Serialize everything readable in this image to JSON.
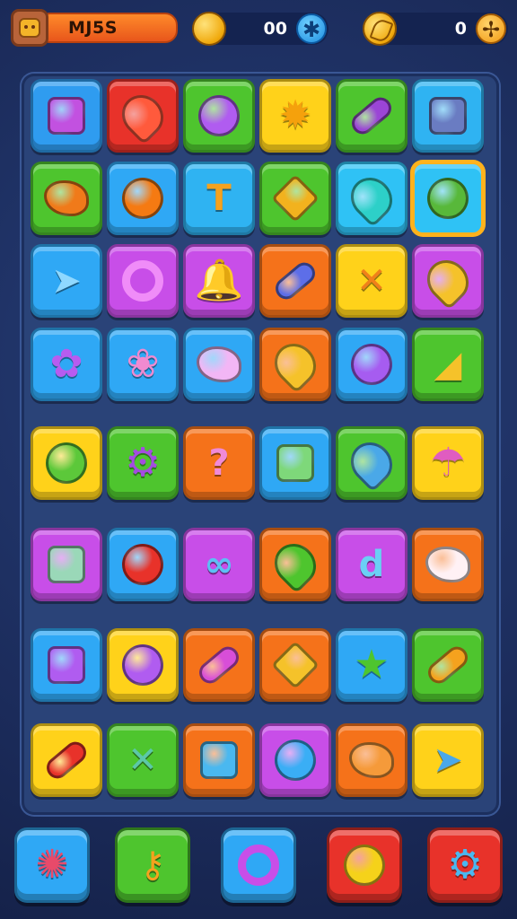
{
  "player": {
    "name": "MJ5S"
  },
  "currencies": [
    {
      "name": "coins",
      "value": "00",
      "icon": "gold-coin-icon"
    },
    {
      "name": "leaves",
      "value": "0",
      "icon": "gold-leaf-icon"
    }
  ],
  "board": {
    "rows": [
      [
        {
          "bg": "#2f9cf0",
          "icon": "robot-cart",
          "shape": "square",
          "color": "#c251e0"
        },
        {
          "bg": "#e8322a",
          "icon": "red-balloon",
          "shape": "drop",
          "color": "#ff5a3c"
        },
        {
          "bg": "#4ec52e",
          "icon": "purple-balloon",
          "shape": "circle",
          "color": "#b05cf0"
        },
        {
          "bg": "#ffd21a",
          "icon": "sun",
          "shape": "star",
          "color": "#f5a10c",
          "glyph": "✹"
        },
        {
          "bg": "#4ec52e",
          "icon": "purple-bug",
          "shape": "pill",
          "color": "#9b45d6"
        },
        {
          "bg": "#2fb3f2",
          "icon": "cassette",
          "shape": "square",
          "color": "#6a7cc2"
        }
      ],
      [
        {
          "bg": "#4ec52e",
          "icon": "orange-whistle",
          "shape": "blob",
          "color": "#f07a1a"
        },
        {
          "bg": "#2fa8f5",
          "icon": "orange-balloon",
          "shape": "circle",
          "color": "#f57a12"
        },
        {
          "bg": "#2fb3f2",
          "icon": "mushroom-stick",
          "shape": "glyph",
          "color": "#f5a21e",
          "glyph": "T"
        },
        {
          "bg": "#4ec52e",
          "icon": "gold-spinner",
          "shape": "diamond",
          "color": "#f2b21e"
        },
        {
          "bg": "#2fc2f5",
          "icon": "teal-shield",
          "shape": "drop",
          "color": "#2dd0c8"
        },
        {
          "bg": "#2fc2f5",
          "icon": "green-melon",
          "shape": "circle",
          "color": "#58b83a",
          "selected": true
        }
      ],
      [
        {
          "bg": "#2fa8f5",
          "icon": "paper-plane",
          "shape": "glyph",
          "color": "#8fd8ff",
          "glyph": "➤"
        },
        {
          "bg": "#c84ee8",
          "icon": "purple-ring",
          "shape": "ring",
          "color": "#f08cf8"
        },
        {
          "bg": "#c84ee8",
          "icon": "gold-bell",
          "shape": "star",
          "color": "#f5b21e",
          "glyph": "🔔"
        },
        {
          "bg": "#f5721a",
          "icon": "blue-gem",
          "shape": "pill",
          "color": "#5d6ee8"
        },
        {
          "bg": "#ffd21a",
          "icon": "crossed-arrows",
          "shape": "glyph",
          "color": "#f0801a",
          "glyph": "✕"
        },
        {
          "bg": "#c84ee8",
          "icon": "gold-rocket",
          "shape": "drop",
          "color": "#f5c22a"
        }
      ],
      [
        {
          "bg": "#2fa8f5",
          "icon": "purple-flower",
          "shape": "star",
          "color": "#b75cf0",
          "glyph": "✿"
        },
        {
          "bg": "#2fa8f5",
          "icon": "pink-lotus",
          "shape": "star",
          "color": "#f08ad0",
          "glyph": "❀"
        },
        {
          "bg": "#2fa8f5",
          "icon": "pink-cloud",
          "shape": "blob",
          "color": "#f2b6f5"
        },
        {
          "bg": "#f5721a",
          "icon": "gold-leaf",
          "shape": "drop",
          "color": "#f5c22a"
        },
        {
          "bg": "#2fa8f5",
          "icon": "purple-bird",
          "shape": "circle",
          "color": "#a65cf0"
        },
        {
          "bg": "#4ec52e",
          "icon": "gold-triangle",
          "shape": "glyph",
          "color": "#f5c22a",
          "glyph": "◢"
        }
      ],
      [
        {
          "bg": "#ffd21a",
          "icon": "green-smiley",
          "shape": "circle",
          "color": "#5cc83a"
        },
        {
          "bg": "#4ec52e",
          "icon": "purple-gear",
          "shape": "star",
          "color": "#a44ce0",
          "glyph": "⚙"
        },
        {
          "bg": "#f5721a",
          "icon": "pink-question",
          "shape": "glyph",
          "color": "#f08ad8",
          "glyph": "?"
        },
        {
          "bg": "#2fa8f5",
          "icon": "green-pencil-card",
          "shape": "square",
          "color": "#7ed87a"
        },
        {
          "bg": "#4ec52e",
          "icon": "blue-leaf",
          "shape": "drop",
          "color": "#4aa8e8"
        },
        {
          "bg": "#ffd21a",
          "icon": "umbrella",
          "shape": "star",
          "color": "#e05cc0",
          "glyph": "☂"
        }
      ],
      [
        {
          "bg": "#c84ee8",
          "icon": "plant-pot",
          "shape": "square",
          "color": "#9ad8b8"
        },
        {
          "bg": "#2fa8f5",
          "icon": "red-ball",
          "shape": "circle",
          "color": "#e8322a"
        },
        {
          "bg": "#c84ee8",
          "icon": "blue-infinity",
          "shape": "glyph",
          "color": "#5cc0f5",
          "glyph": "∞"
        },
        {
          "bg": "#f5721a",
          "icon": "green-plant",
          "shape": "drop",
          "color": "#4ec52e"
        },
        {
          "bg": "#c84ee8",
          "icon": "blue-letter",
          "shape": "glyph",
          "color": "#6ad0f5",
          "glyph": "d"
        },
        {
          "bg": "#f5721a",
          "icon": "bunny-face",
          "shape": "blob",
          "color": "#fff1f5"
        }
      ],
      [
        {
          "bg": "#2fa8f5",
          "icon": "purple-box",
          "shape": "square",
          "color": "#b05cf0"
        },
        {
          "bg": "#ffd21a",
          "icon": "purple-egg",
          "shape": "circle",
          "color": "#b05cf0"
        },
        {
          "bg": "#f5721a",
          "icon": "purple-lantern",
          "shape": "pill",
          "color": "#d84ed8"
        },
        {
          "bg": "#f5721a",
          "icon": "gold-tile",
          "shape": "diamond",
          "color": "#f5c22a"
        },
        {
          "bg": "#2fa8f5",
          "icon": "green-star",
          "shape": "star",
          "color": "#4ec52e",
          "glyph": "★"
        },
        {
          "bg": "#4ec52e",
          "icon": "pencil",
          "shape": "pill",
          "color": "#f5a21e"
        }
      ],
      [
        {
          "bg": "#ffd21a",
          "icon": "red-chili",
          "shape": "pill",
          "color": "#e8322a"
        },
        {
          "bg": "#4ec52e",
          "icon": "green-sword",
          "shape": "glyph",
          "color": "#5cc8a8",
          "glyph": "✕"
        },
        {
          "bg": "#f5721a",
          "icon": "blue-key",
          "shape": "square",
          "color": "#4ab8f0"
        },
        {
          "bg": "#c84ee8",
          "icon": "blue-balloon",
          "shape": "circle",
          "color": "#3aaef5"
        },
        {
          "bg": "#f5721a",
          "icon": "orange-heart",
          "shape": "blob",
          "color": "#f59a3a"
        },
        {
          "bg": "#ffd21a",
          "icon": "blue-plane",
          "shape": "glyph",
          "color": "#4aa8e8",
          "glyph": "➤"
        }
      ]
    ]
  },
  "powerups": [
    {
      "name": "sun-badge",
      "bg": "#2fa8f5",
      "shape": "star",
      "color": "#e84a6a",
      "glyph": "✺"
    },
    {
      "name": "key-tool",
      "bg": "#4ec52e",
      "shape": "glyph",
      "color": "#f5a21e",
      "glyph": "⚷"
    },
    {
      "name": "purple-orb",
      "bg": "#2fa8f5",
      "shape": "ring",
      "color": "#c84ee8"
    },
    {
      "name": "apple",
      "bg": "#e8322a",
      "shape": "circle",
      "color": "#f5d21a"
    },
    {
      "name": "blue-gear",
      "bg": "#e8322a",
      "shape": "star",
      "color": "#4ab8f0",
      "glyph": "⚙"
    }
  ]
}
